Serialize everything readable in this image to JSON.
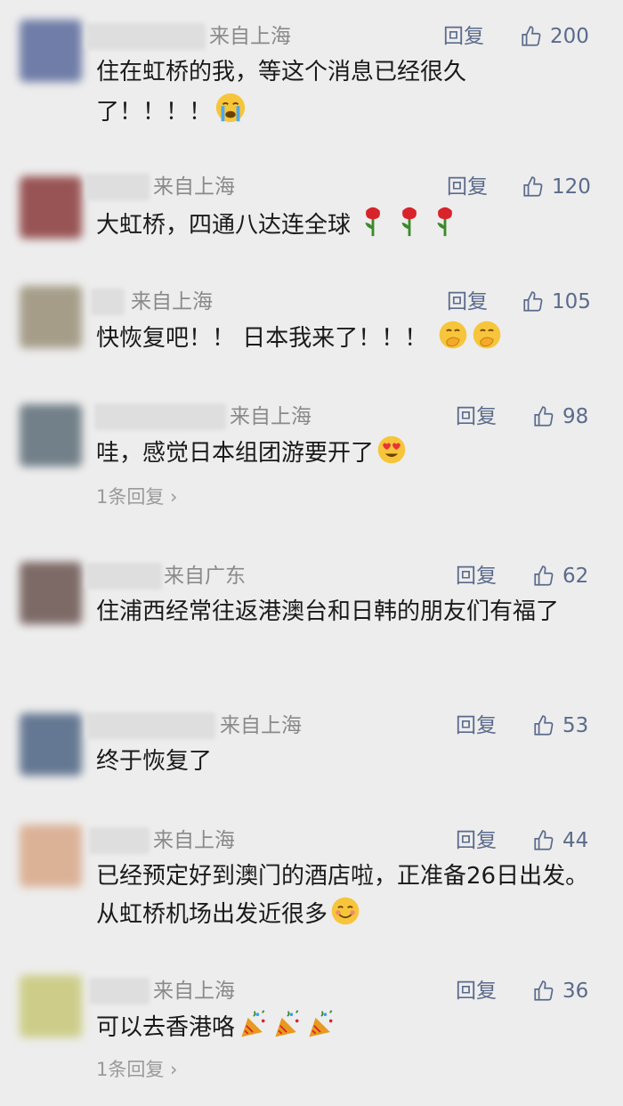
{
  "comments": [
    {
      "location": "来自上海",
      "reply": "回复",
      "likes": "200",
      "text": "住在虹桥的我，等这个消息已经很久了！！！！",
      "emoji": "crying-face-icon"
    },
    {
      "location": "来自上海",
      "reply": "回复",
      "likes": "120",
      "text": "大虹桥，四通八达连全球",
      "emoji": "rose-icon"
    },
    {
      "location": "来自上海",
      "reply": "回复",
      "likes": "105",
      "text": "快恢复吧！！ 日本我来了！！！",
      "emoji": "hand-over-mouth-icon"
    },
    {
      "location": "来自上海",
      "reply": "回复",
      "likes": "98",
      "text": "哇，感觉日本组团游要开了",
      "emoji": "heart-eyes-icon",
      "sub": "1条回复 ›"
    },
    {
      "location": "来自广东",
      "reply": "回复",
      "likes": "62",
      "text": "住浦西经常往返港澳台和日韩的朋友们有福了"
    },
    {
      "location": "来自上海",
      "reply": "回复",
      "likes": "53",
      "text": "终于恢复了"
    },
    {
      "location": "来自上海",
      "reply": "回复",
      "likes": "44",
      "text": "已经预定好到澳门的酒店啦，正准备26日出发。从虹桥机场出发近很多",
      "emoji": "smiling-face-icon"
    },
    {
      "location": "来自上海",
      "reply": "回复",
      "likes": "36",
      "text": "可以去香港咯",
      "emoji": "party-popper-icon",
      "sub": "1条回复 ›"
    }
  ]
}
